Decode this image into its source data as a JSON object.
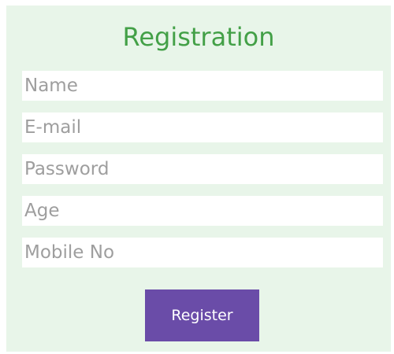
{
  "form": {
    "title": "Registration",
    "fields": [
      {
        "placeholder": "Name",
        "value": ""
      },
      {
        "placeholder": "E-mail",
        "value": ""
      },
      {
        "placeholder": "Password",
        "value": ""
      },
      {
        "placeholder": "Age",
        "value": ""
      },
      {
        "placeholder": "Mobile No",
        "value": ""
      }
    ],
    "submit_label": "Register"
  },
  "colors": {
    "card_background": "#e8f5e9",
    "title": "#43a047",
    "button": "#6a4ca8",
    "button_text": "#ffffff",
    "placeholder": "#9e9e9e"
  }
}
